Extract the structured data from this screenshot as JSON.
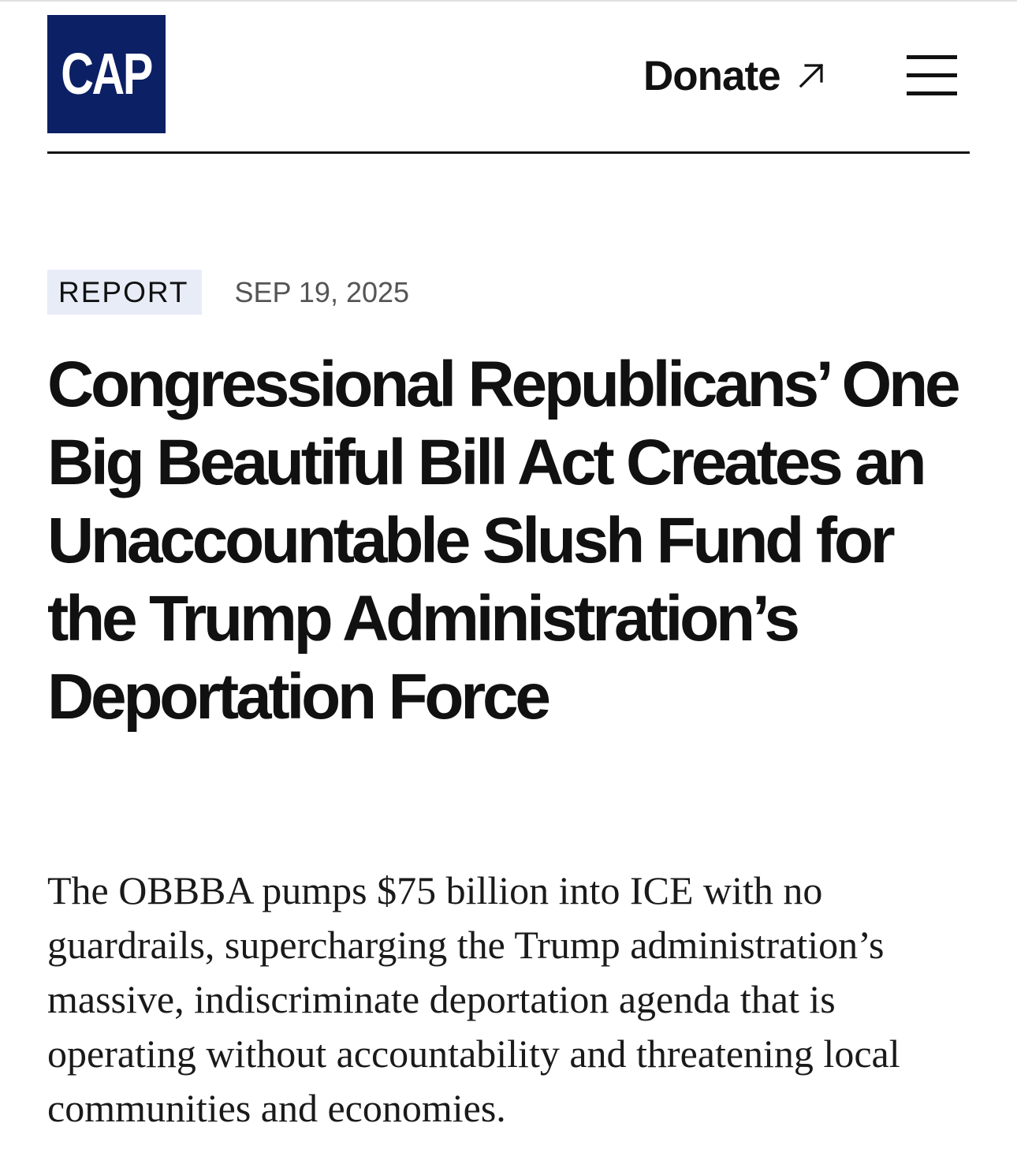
{
  "header": {
    "logo_text": "CAP",
    "donate_label": "Donate",
    "brand_color": "#0c2065",
    "menu_icon": "hamburger-icon",
    "donate_icon": "arrow-up-right-icon"
  },
  "article": {
    "category": "REPORT",
    "date": "SEP 19, 2025",
    "title": "Congressional Republicans’ One Big Beautiful Bill Act Creates an Unaccountable Slush Fund for the Trump Administration’s Deportation Force",
    "summary": "The OBBBA pumps $75 billion into ICE with no guardrails, supercharging the Trump administration’s massive, indiscriminate deportation agenda that is operating without accountability and threatening local communities and economies.",
    "tag_background": "#e8ecf7"
  }
}
